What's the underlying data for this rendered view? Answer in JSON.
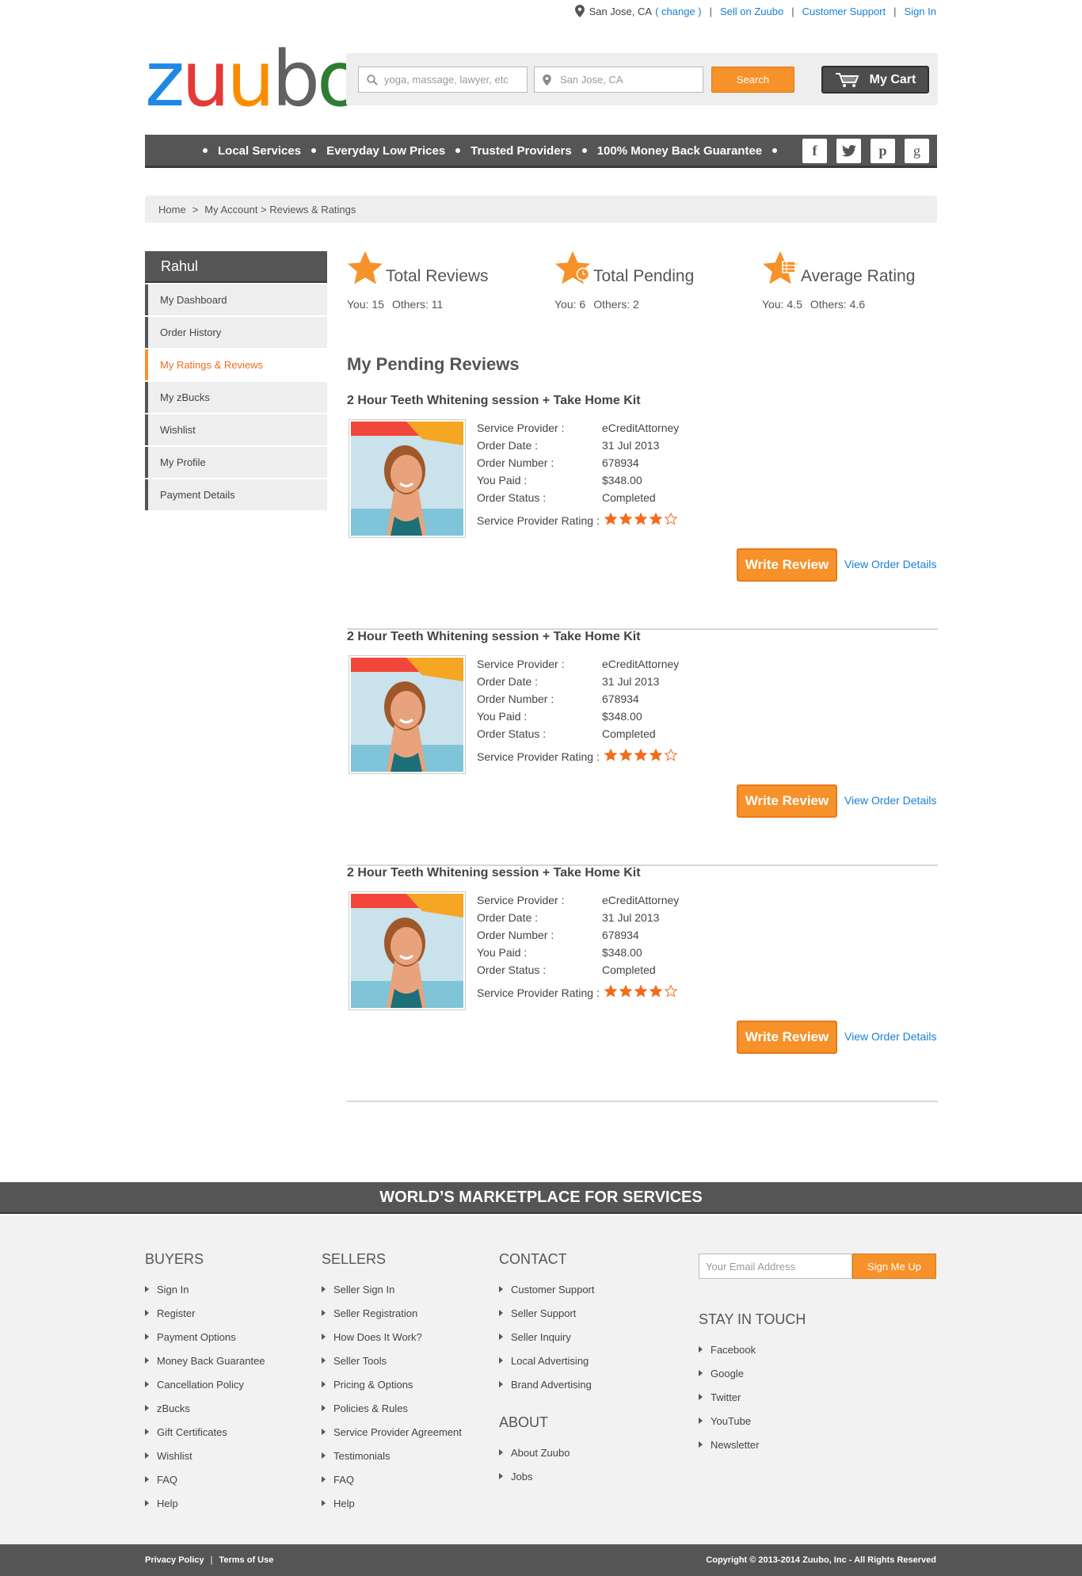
{
  "topbar": {
    "location": "San Jose, CA",
    "change": "( change )",
    "sell": "Sell on Zuubo",
    "support": "Customer Support",
    "signin": "Sign In"
  },
  "header": {
    "logo_letters": [
      "z",
      "u",
      "u",
      "b",
      "o"
    ],
    "logo_colors": [
      "#1e88e5",
      "#e53935",
      "#fb8c00",
      "#616161",
      "#2e7d32"
    ],
    "search_placeholder": "yoga, massage, lawyer, etc",
    "location_placeholder": "San Jose, CA",
    "search_label": "Search",
    "cart_label": "My Cart"
  },
  "nav": {
    "items": [
      "Local Services",
      "Everyday Low Prices",
      "Trusted Providers",
      "100% Money Back Guarantee"
    ],
    "social": [
      "facebook-icon",
      "twitter-icon",
      "pinterest-icon",
      "google-icon"
    ]
  },
  "breadcrumb": {
    "home": "Home",
    "sep": ">",
    "account": "My Account > Reviews & Ratings"
  },
  "sidebar": {
    "user": "Rahul",
    "items": [
      "My Dashboard",
      "Order History",
      "My Ratings & Reviews",
      "My zBucks",
      "Wishlist",
      "My Profile",
      "Payment Details"
    ],
    "active_index": 2
  },
  "stats": [
    {
      "title": "Total Reviews",
      "you": "You: 15",
      "others": "Others: 11"
    },
    {
      "title": "Total Pending",
      "you": "You: 6",
      "others": "Others: 2"
    },
    {
      "title": "Average Rating",
      "you": "You: 4.5",
      "others": "Others: 4.6"
    }
  ],
  "pending_title": "My Pending Reviews",
  "orders": [
    {
      "title": "2 Hour Teeth Whitening  session + Take Home Kit",
      "provider_label": "Service Provider :",
      "provider": "eCreditAttorney",
      "date_label": "Order Date :",
      "date": "31 Jul 2013",
      "number_label": "Order Number :",
      "number": "678934",
      "paid_label": "You Paid :",
      "paid": "$348.00",
      "status_label": "Order Status :",
      "status": "Completed",
      "rating_label": "Service Provider Rating :",
      "rating": 4,
      "rating_max": 5,
      "write_label": "Write Review",
      "view_label": "View Order Details"
    },
    {
      "title": "2 Hour Teeth Whitening  session + Take Home Kit",
      "provider_label": "Service Provider :",
      "provider": "eCreditAttorney",
      "date_label": "Order Date :",
      "date": "31 Jul 2013",
      "number_label": "Order Number :",
      "number": "678934",
      "paid_label": "You Paid :",
      "paid": "$348.00",
      "status_label": "Order Status :",
      "status": "Completed",
      "rating_label": "Service Provider Rating :",
      "rating": 4,
      "rating_max": 5,
      "write_label": "Write Review",
      "view_label": "View Order Details"
    },
    {
      "title": "2 Hour Teeth Whitening  session + Take Home Kit",
      "provider_label": "Service Provider :",
      "provider": "eCreditAttorney",
      "date_label": "Order Date :",
      "date": "31 Jul 2013",
      "number_label": "Order Number :",
      "number": "678934",
      "paid_label": "You Paid :",
      "paid": "$348.00",
      "status_label": "Order Status :",
      "status": "Completed",
      "rating_label": "Service Provider Rating :",
      "rating": 4,
      "rating_max": 5,
      "write_label": "Write Review",
      "view_label": "View Order Details"
    }
  ],
  "footer": {
    "band": "WORLD’S MARKETPLACE FOR SERVICES",
    "buyers": {
      "title": "BUYERS",
      "items": [
        "Sign In",
        "Register",
        "Payment Options",
        "Money Back Guarantee",
        "Cancellation Policy",
        "zBucks",
        "Gift Certificates",
        "Wishlist",
        "FAQ",
        "Help"
      ]
    },
    "sellers": {
      "title": "SELLERS",
      "items": [
        "Seller Sign In",
        "Seller Registration",
        "How Does It Work?",
        "Seller Tools",
        "Pricing & Options",
        "Policies & Rules",
        "Service Provider Agreement",
        "Testimonials",
        "FAQ",
        "Help"
      ]
    },
    "contact": {
      "title": "CONTACT",
      "items": [
        "Customer Support",
        "Seller Support",
        "Seller Inquiry",
        "Local Advertising",
        "Brand Advertising"
      ]
    },
    "about": {
      "title": "ABOUT",
      "items": [
        "About Zuubo",
        "Jobs"
      ]
    },
    "email_placeholder": "Your Email Address",
    "signup_label": "Sign Me Up",
    "stay": {
      "title": "STAY IN TOUCH",
      "items": [
        "Facebook",
        "Google",
        "Twitter",
        "YouTube",
        "Newsletter"
      ]
    },
    "privacy": "Privacy Policy",
    "sep": "|",
    "terms": "Terms of Use",
    "copyright": "Copyright © 2013-2014 Zuubo, Inc - All Rights Reserved"
  },
  "colors": {
    "accent": "#f7912a",
    "link": "#1a7fd6",
    "dark": "#555555",
    "star": "#f26c1c"
  }
}
